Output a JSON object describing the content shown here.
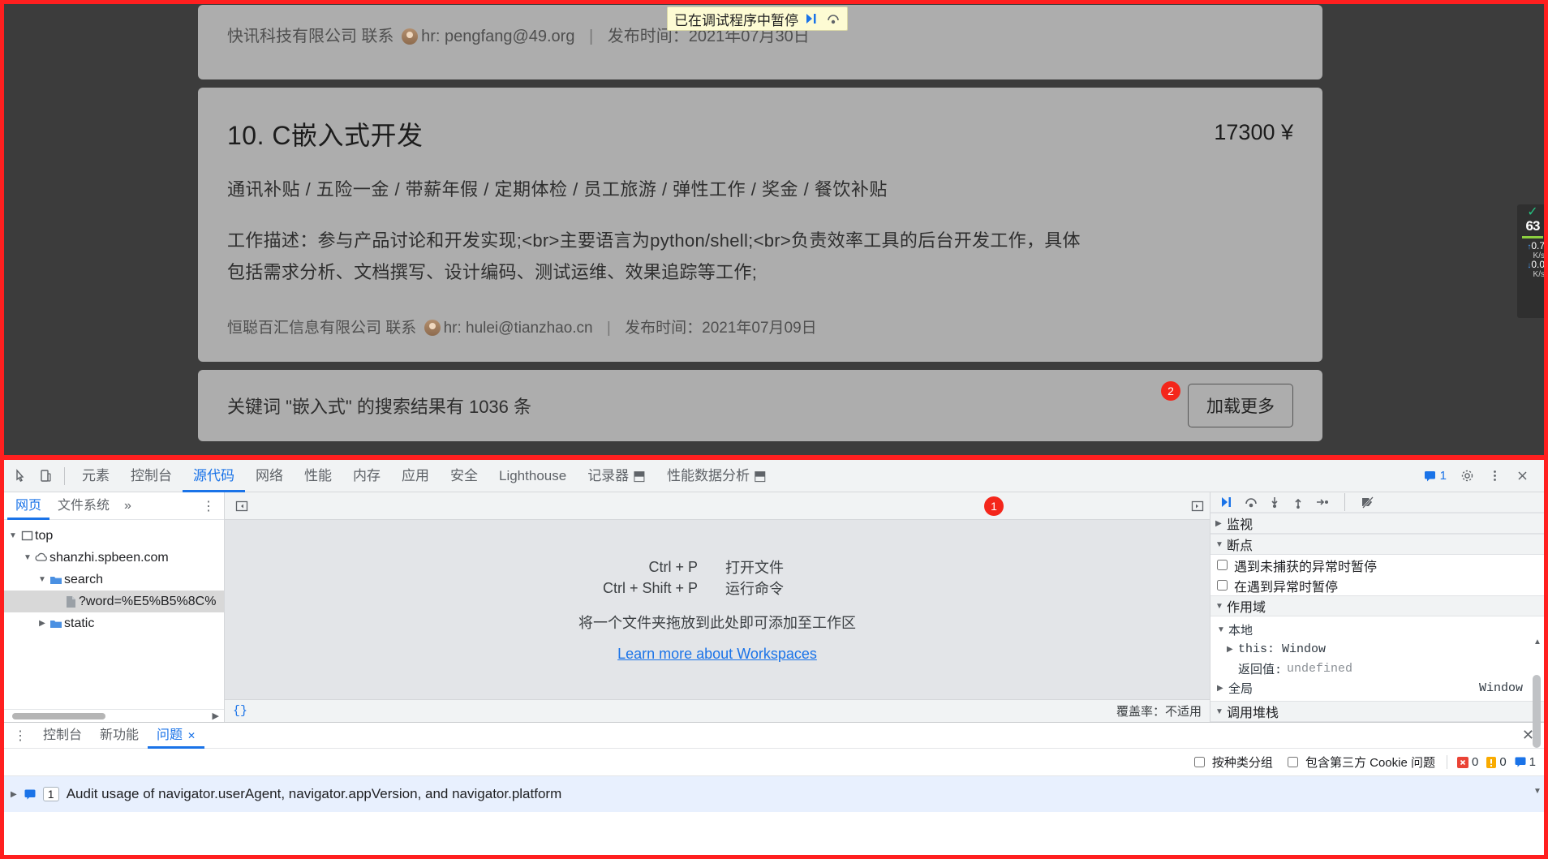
{
  "page": {
    "partial_card": {
      "company": "快讯科技有限公司 联系",
      "hr_label": "hr: pengfang@49.org",
      "publish": "发布时间：2021年07月30日"
    },
    "job": {
      "title": "10. C嵌入式开发",
      "salary": "17300 ¥",
      "tags": "通讯补贴 / 五险一金 / 带薪年假 / 定期体检 / 员工旅游 / 弹性工作 / 奖金 / 餐饮补贴",
      "desc_line1": "工作描述：参与产品讨论和开发实现;<br>主要语言为python/shell;<br>负责效率工具的后台开发工作，具体",
      "desc_line2": "包括需求分析、文档撰写、设计编码、测试运维、效果追踪等工作;",
      "company": "恒聪百汇信息有限公司 联系",
      "hr_label": "hr: hulei@tianzhao.cn",
      "publish": "发布时间：2021年07月09日"
    },
    "footer": {
      "result_text": "关键词 \"嵌入式\" 的搜索结果有 1036 条",
      "load_more": "加载更多",
      "step_badge": "2"
    },
    "pause_banner": {
      "text": "已在调试程序中暂停",
      "resume_icon": "resume-script-icon",
      "step-over_icon": "step-over-icon"
    },
    "net_widget": {
      "check": "✓",
      "value": "63",
      "up_value": "0.7",
      "up_unit": "K/s",
      "down_value": "0.0",
      "down_unit": "K/s"
    }
  },
  "devtools": {
    "tabs": [
      {
        "label": "元素",
        "active": false
      },
      {
        "label": "控制台",
        "active": false
      },
      {
        "label": "源代码",
        "active": true
      },
      {
        "label": "网络",
        "active": false
      },
      {
        "label": "性能",
        "active": false
      },
      {
        "label": "内存",
        "active": false
      },
      {
        "label": "应用",
        "active": false
      },
      {
        "label": "安全",
        "active": false
      },
      {
        "label": "Lighthouse",
        "active": false
      },
      {
        "label": "记录器 ⬒",
        "active": false
      },
      {
        "label": "性能数据分析 ⬒",
        "active": false
      }
    ],
    "message_count": "1",
    "step_badge": "1",
    "navigator": {
      "tabs": [
        {
          "label": "网页",
          "active": true
        },
        {
          "label": "文件系统",
          "active": false
        }
      ],
      "more": "»",
      "kebab": "⋮",
      "tree": [
        {
          "label": "top",
          "icon": "frame-icon",
          "depth": 0,
          "twisty": "▼",
          "selected": false
        },
        {
          "label": "shanzhi.spbeen.com",
          "icon": "cloud-icon",
          "depth": 1,
          "twisty": "▼",
          "selected": false
        },
        {
          "label": "search",
          "icon": "folder-icon",
          "depth": 2,
          "twisty": "▼",
          "selected": false
        },
        {
          "label": "?word=%E5%B5%8C%",
          "icon": "document-icon",
          "depth": 3,
          "twisty": "",
          "selected": true
        },
        {
          "label": "static",
          "icon": "folder-icon",
          "depth": 2,
          "twisty": "▶",
          "selected": false
        }
      ]
    },
    "editor": {
      "shortcuts": [
        {
          "keys": "Ctrl + P",
          "what": "打开文件"
        },
        {
          "keys": "Ctrl + Shift + P",
          "what": "运行命令"
        }
      ],
      "drop_hint": "将一个文件夹拖放到此处即可添加至工作区",
      "workspaces_link": "Learn more about Workspaces",
      "format_button": "{}",
      "coverage": "覆盖率：不适用"
    },
    "debugger": {
      "toolbar_icons": [
        "resume-icon",
        "step-over-icon",
        "step-into-icon",
        "step-out-icon",
        "step-icon",
        "deactivate-breakpoints-icon"
      ],
      "sections": [
        {
          "label": "监视",
          "caret": "▶"
        },
        {
          "label": "断点",
          "caret": "▼"
        },
        {
          "label": "作用域",
          "caret": "▼"
        },
        {
          "label": "调用堆栈",
          "caret": "▼"
        }
      ],
      "breakpoint_options": [
        {
          "label": "遇到未捕获的异常时暂停",
          "checked": false
        },
        {
          "label": "在遇到异常时暂停",
          "checked": false
        }
      ],
      "scope": {
        "local_label": "本地",
        "this_label": "this: Window",
        "return_label": "返回值:",
        "return_value": "undefined",
        "global_label": "全局",
        "global_value": "Window"
      }
    },
    "drawer": {
      "tabs": [
        {
          "label": "控制台",
          "active": false,
          "closable": false
        },
        {
          "label": "新功能",
          "active": false,
          "closable": false
        },
        {
          "label": "问题",
          "active": true,
          "closable": true
        }
      ],
      "group_by_kind": "按种类分组",
      "include_cookies": "包含第三方 Cookie 问题",
      "counts": {
        "errors": "0",
        "warnings": "0",
        "info": "1"
      },
      "issue": {
        "badge": "1",
        "text": "Audit usage of navigator.userAgent, navigator.appVersion, and navigator.platform"
      }
    }
  },
  "colors": {
    "accent": "#1a73e8",
    "highlight_frame": "#ff1f1f",
    "page_card": "#adadad",
    "issue_row": "#e8f0fe"
  }
}
